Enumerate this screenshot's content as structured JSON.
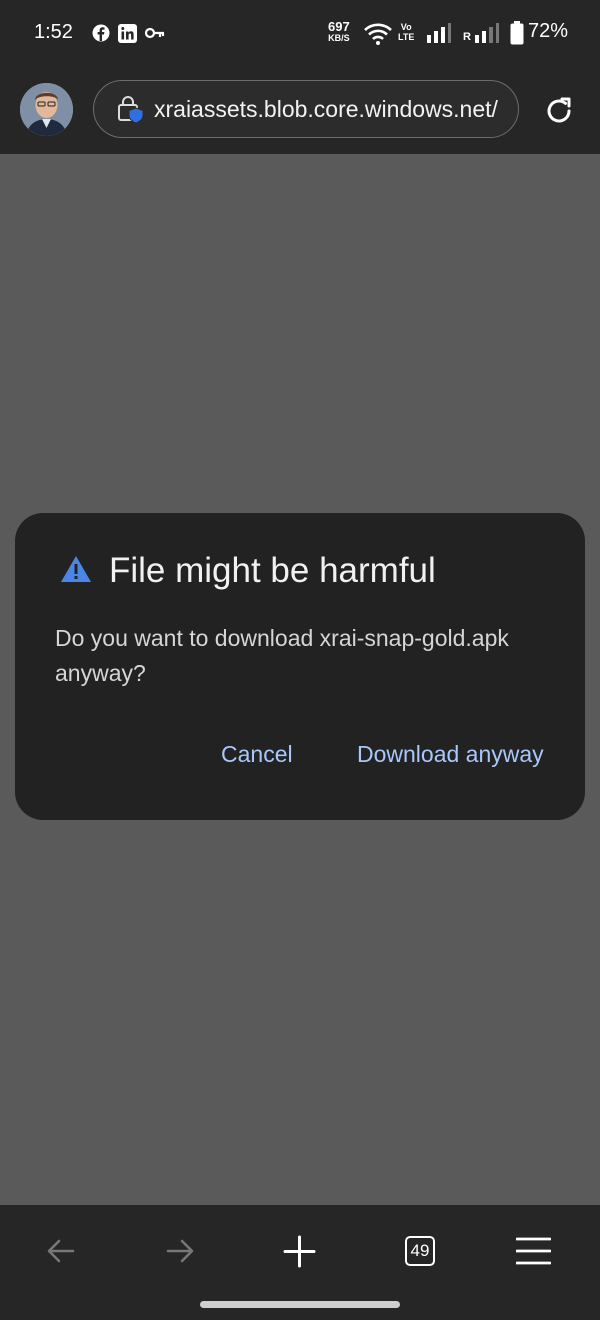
{
  "status_bar": {
    "time": "1:52",
    "notification_icons": [
      "facebook-icon",
      "linkedin-icon",
      "key-icon"
    ],
    "net_speed_value": "697",
    "net_speed_unit": "KB/S",
    "volte_line1": "Vo",
    "volte_line2": "LTE",
    "roaming_label": "R",
    "battery_percent": "72%"
  },
  "toolbar": {
    "url": "xraiassets.blob.core.windows.net/",
    "colors": {
      "background": "#262626",
      "shield_accent": "#2f6fe0"
    }
  },
  "dialog": {
    "title": "File might be harmful",
    "message": "Do you want to download xrai-snap-gold.apk anyway?",
    "cancel_label": "Cancel",
    "confirm_label": "Download anyway",
    "colors": {
      "background": "#222222",
      "button_text": "#a8c7fa",
      "warning_icon": "#4a86e8"
    }
  },
  "bottom_bar": {
    "tab_count": "49"
  }
}
